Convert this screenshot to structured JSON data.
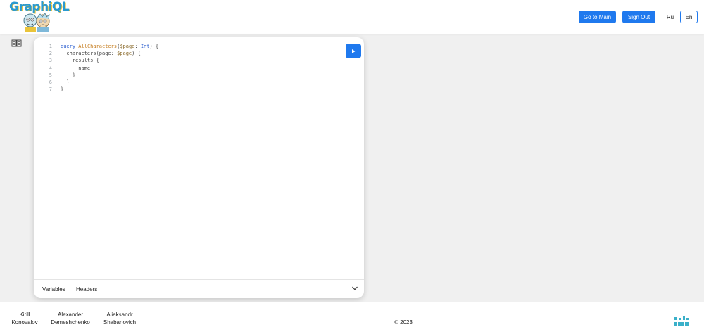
{
  "header": {
    "logo_text": "GraphiQL",
    "go_to_main": "Go to Main",
    "sign_out": "Sign Out",
    "lang_ru": "Ru",
    "lang_en": "En"
  },
  "editor": {
    "line_numbers": [
      "1",
      "2",
      "3",
      "4",
      "5",
      "6",
      "7"
    ],
    "tabs": {
      "variables": "Variables",
      "headers": "Headers"
    }
  },
  "footer": {
    "authors": [
      {
        "first": "Kirill",
        "last": "Konovalov"
      },
      {
        "first": "Alexander",
        "last": "Demeshchenko"
      },
      {
        "first": "Aliaksandr",
        "last": "Shabanovich"
      }
    ],
    "copyright": "© 2023"
  },
  "colors": {
    "accent": "#1f79ee",
    "logo_blue": "#2a9ad0",
    "logo_yellow": "#e9c43a"
  }
}
